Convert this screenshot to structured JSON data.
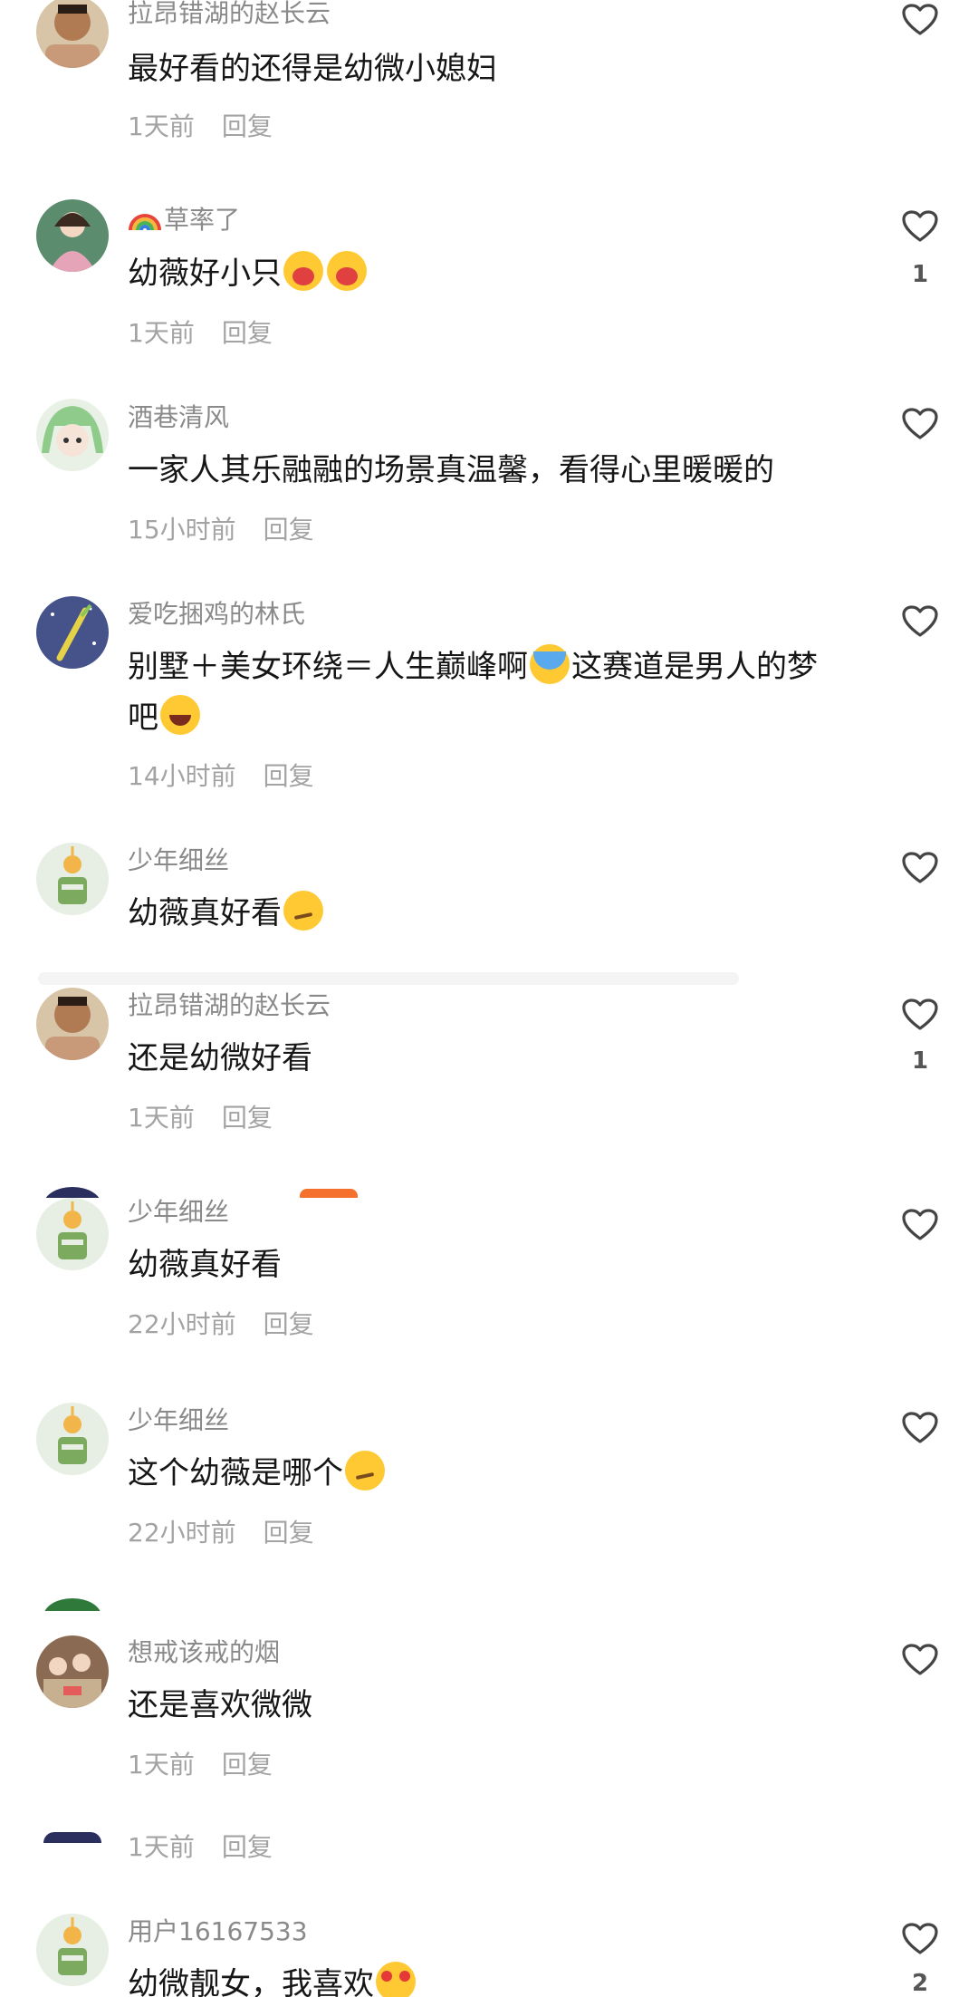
{
  "comments": [
    {
      "username": "拉昂错湖的赵长云",
      "text": "最好看的还得是幼微小媳妇",
      "time": "1天前",
      "reply": "回复",
      "likes": ""
    },
    {
      "username": "草率了",
      "text": "幼薇好小只",
      "time": "1天前",
      "reply": "回复",
      "likes": "1"
    },
    {
      "username": "酒巷清风",
      "text": "一家人其乐融融的场景真温馨，看得心里暖暖的",
      "time": "15小时前",
      "reply": "回复",
      "likes": ""
    },
    {
      "username": "爱吃捆鸡的林氏",
      "text_a": "别墅＋美女环绕＝人生巅峰啊",
      "text_b": "这赛道是男人的梦",
      "text_c": "吧",
      "time": "14小时前",
      "reply": "回复",
      "likes": ""
    },
    {
      "username": "少年细丝",
      "text": "幼薇真好看",
      "time": "",
      "reply": "",
      "likes": ""
    },
    {
      "username": "拉昂错湖的赵长云",
      "text": "还是幼微好看",
      "time": "1天前",
      "reply": "回复",
      "likes": "1"
    },
    {
      "username": "少年细丝",
      "text": "幼薇真好看",
      "time": "22小时前",
      "reply": "回复",
      "likes": ""
    },
    {
      "username": "少年细丝",
      "text": "这个幼薇是哪个",
      "time": "22小时前",
      "reply": "回复",
      "likes": ""
    },
    {
      "username": "想戒该戒的烟",
      "text": "还是喜欢微微",
      "time": "1天前",
      "reply": "回复",
      "likes": ""
    },
    {
      "username": "",
      "text": "",
      "time": "1天前",
      "reply": "回复",
      "likes": ""
    },
    {
      "username": "用户16167533",
      "text": "幼微靓女，我喜欢",
      "time": "",
      "reply": "",
      "likes": "2"
    }
  ],
  "icons": {
    "like": "heart-outline-icon",
    "rainbow": "rainbow-emoji",
    "blush": "blush-emoji",
    "cry": "crying-emoji",
    "laugh": "laughing-emoji",
    "smirk": "smirk-emoji",
    "heart_eyes": "heart-eyes-emoji"
  },
  "colors": {
    "username": "#8a8a8a",
    "text": "#161616",
    "meta": "#a3a3a3",
    "background": "#ffffff"
  }
}
